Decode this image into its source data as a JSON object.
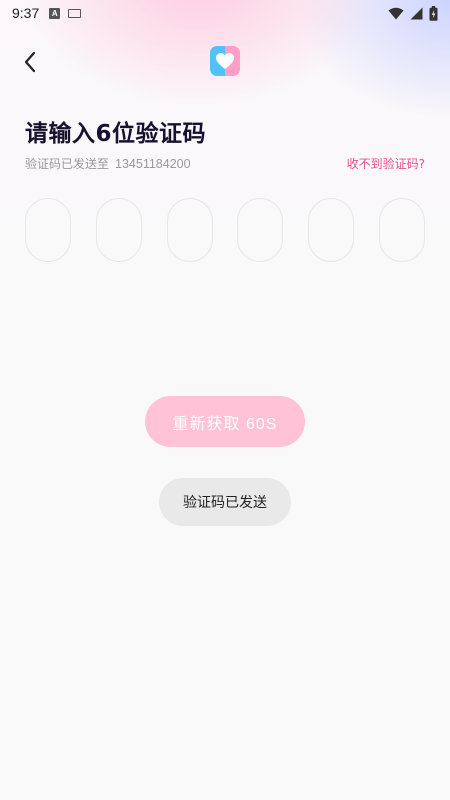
{
  "status_bar": {
    "time": "9:37",
    "left_icons": [
      "a-badge-icon",
      "keyboard-icon"
    ],
    "right_icons": [
      "wifi-icon",
      "signal-icon",
      "battery-icon"
    ]
  },
  "header": {
    "back_icon": "chevron-left-icon",
    "logo_icon": "heart-icon"
  },
  "main": {
    "title": "请输入6位验证码",
    "sent_prefix": "验证码已发送至",
    "phone": "13451184200",
    "no_code_link": "收不到验证码?",
    "code_digits": [
      "",
      "",
      "",
      "",
      "",
      ""
    ],
    "resend_label": "重新获取 60S"
  },
  "toast": {
    "text": "验证码已发送"
  },
  "colors": {
    "accent_pink": "#ea4f8f",
    "button_pink": "#ffc2d6",
    "title_dark": "#15112e"
  }
}
